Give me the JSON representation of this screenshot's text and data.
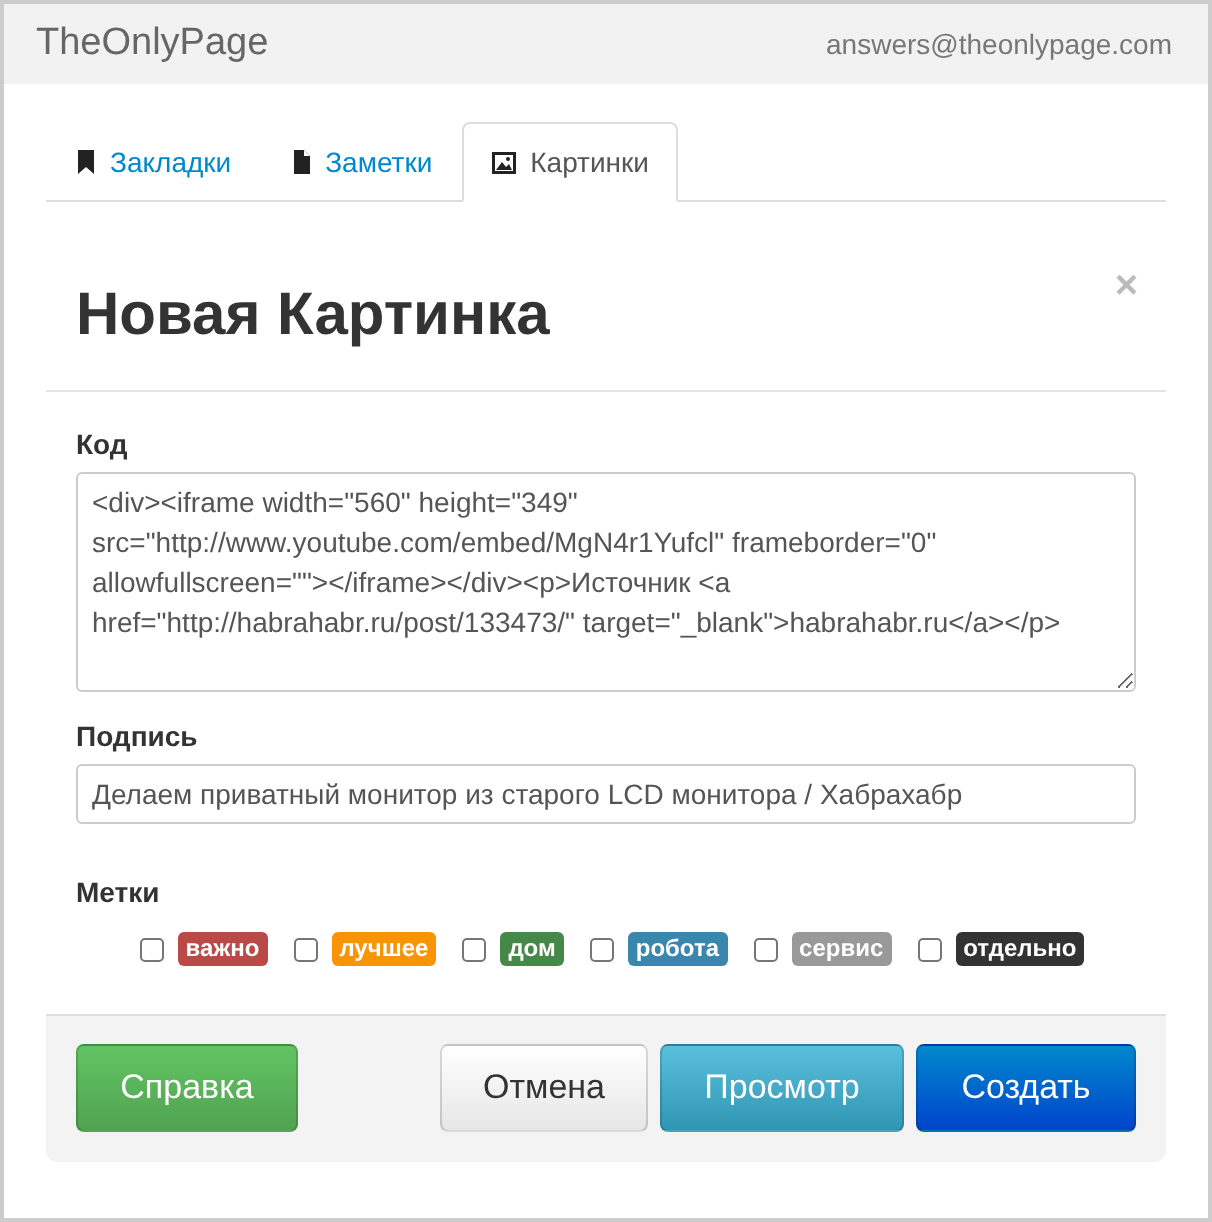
{
  "header": {
    "brand": "TheOnlyPage",
    "email": "answers@theonlypage.com"
  },
  "tabs": [
    {
      "label": "Закладки",
      "kind": "bookmark",
      "selected": false
    },
    {
      "label": "Заметки",
      "kind": "file",
      "selected": false
    },
    {
      "label": "Картинки",
      "kind": "image",
      "selected": true
    }
  ],
  "modal": {
    "title": "Новая Картинка",
    "close": "×"
  },
  "code": {
    "label": "Код",
    "value": "<div><iframe width=\"560\" height=\"349\" src=\"http://www.youtube.com/embed/MgN4r1Yufcl\" frameborder=\"0\" allowfullscreen=\"\"></iframe></div><p>Источник <a href=\"http://habrahabr.ru/post/133473/\" target=\"_blank\">habrahabr.ru</a></p>"
  },
  "caption": {
    "label": "Подпись",
    "value": "Делаем приватный монитор из старого LCD монитора / Хабрахабр"
  },
  "tags": {
    "label": "Метки",
    "items": [
      {
        "label": "важно",
        "color": "#b94a48",
        "checked": false
      },
      {
        "label": "лучшее",
        "color": "#f89406",
        "checked": false
      },
      {
        "label": "дом",
        "color": "#468847",
        "checked": false
      },
      {
        "label": "робота",
        "color": "#3a87ad",
        "checked": false
      },
      {
        "label": "сервис",
        "color": "#999999",
        "checked": false
      },
      {
        "label": "отдельно",
        "color": "#333333",
        "checked": false
      }
    ]
  },
  "buttons": [
    {
      "label": "Справка",
      "kind": "help"
    },
    {
      "label": "Отмена",
      "kind": "cancel"
    },
    {
      "label": "Просмотр",
      "kind": "preview"
    },
    {
      "label": "Создать",
      "kind": "create"
    }
  ]
}
